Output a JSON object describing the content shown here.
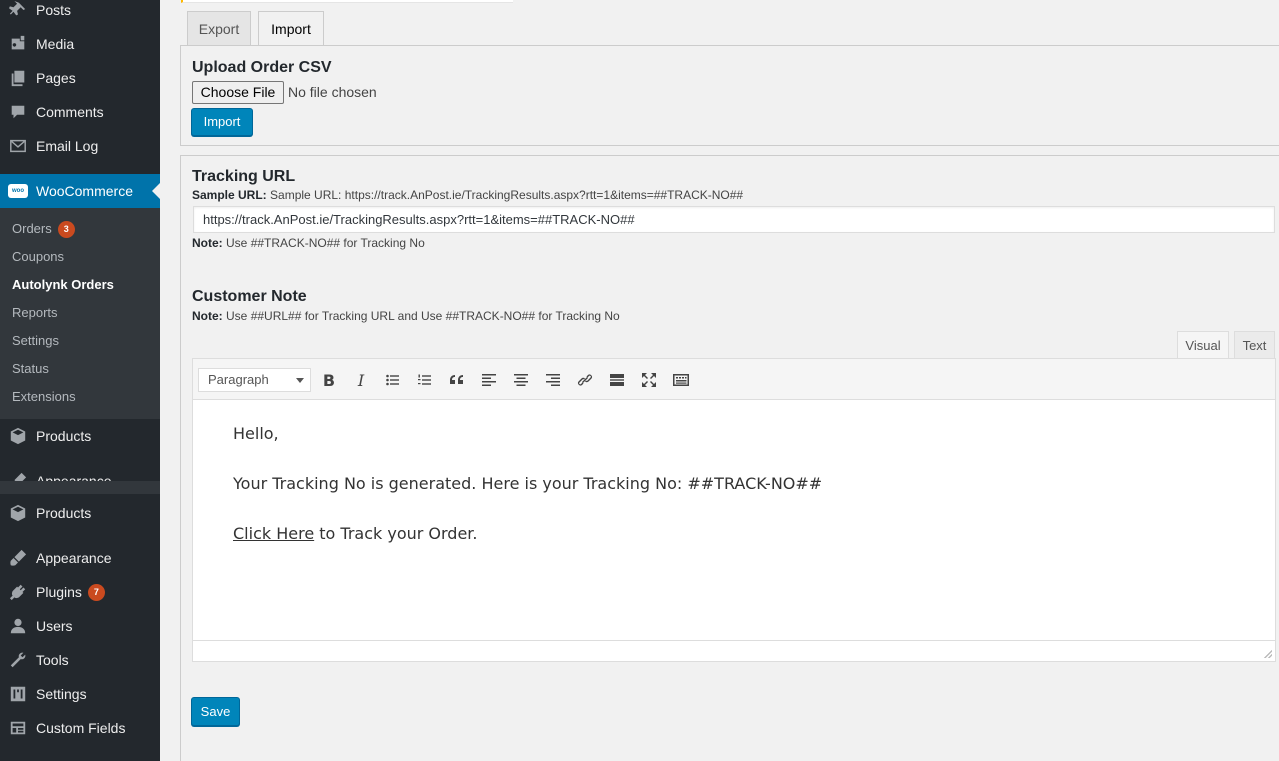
{
  "sidebar": {
    "items_top": [
      {
        "label": "Posts",
        "icon": "pin-icon"
      },
      {
        "label": "Media",
        "icon": "media-icon"
      },
      {
        "label": "Pages",
        "icon": "pages-icon"
      },
      {
        "label": "Comments",
        "icon": "comment-icon"
      },
      {
        "label": "Email Log",
        "icon": "email-icon"
      }
    ],
    "woocommerce": {
      "label": "WooCommerce",
      "icon_text": "woo"
    },
    "submenu": [
      {
        "label": "Orders",
        "badge": "3"
      },
      {
        "label": "Coupons"
      },
      {
        "label": "Autolynk Orders"
      },
      {
        "label": "Reports"
      },
      {
        "label": "Settings"
      },
      {
        "label": "Status"
      },
      {
        "label": "Extensions"
      }
    ],
    "products_1": "Products",
    "appearance_partial": "Appearance",
    "items_bottom": [
      {
        "label": "Products",
        "icon": "products-icon"
      },
      {
        "label": "Appearance",
        "icon": "paintbrush-icon"
      },
      {
        "label": "Plugins",
        "icon": "plugin-icon",
        "badge": "7"
      },
      {
        "label": "Users",
        "icon": "user-icon"
      },
      {
        "label": "Tools",
        "icon": "wrench-icon"
      },
      {
        "label": "Settings",
        "icon": "settings-icon"
      },
      {
        "label": "Custom Fields",
        "icon": "grid-icon"
      }
    ]
  },
  "tabs": {
    "export": "Export",
    "import": "Import"
  },
  "upload": {
    "title": "Upload Order CSV",
    "choose_file": "Choose File",
    "no_file": "No file chosen",
    "import_button": "Import"
  },
  "tracking": {
    "title": "Tracking URL",
    "sample_label": "Sample URL:",
    "sample_text": "Sample URL: https://track.AnPost.ie/TrackingResults.aspx?rtt=1&items=##TRACK-NO##",
    "url_value": "https://track.AnPost.ie/TrackingResults.aspx?rtt=1&items=##TRACK-NO##",
    "note_label": "Note:",
    "note_text": "Use ##TRACK-NO## for Tracking No"
  },
  "customer_note": {
    "title": "Customer Note",
    "note_label": "Note:",
    "note_text": "Use ##URL## for Tracking URL and Use ##TRACK-NO## for Tracking No"
  },
  "editor": {
    "tab_visual": "Visual",
    "tab_text": "Text",
    "format": "Paragraph",
    "content": {
      "line1": "Hello,",
      "line2": "Your Tracking No is generated. Here is your Tracking No: ##TRACK-NO##",
      "link": "Click Here",
      "line3_rest": " to Track your Order."
    }
  },
  "save_button": "Save",
  "colors": {
    "sidebar_bg": "#23282d",
    "submenu_bg": "#32373c",
    "accent": "#0073aa",
    "button": "#0085ba",
    "badge": "#ca4a1f"
  }
}
